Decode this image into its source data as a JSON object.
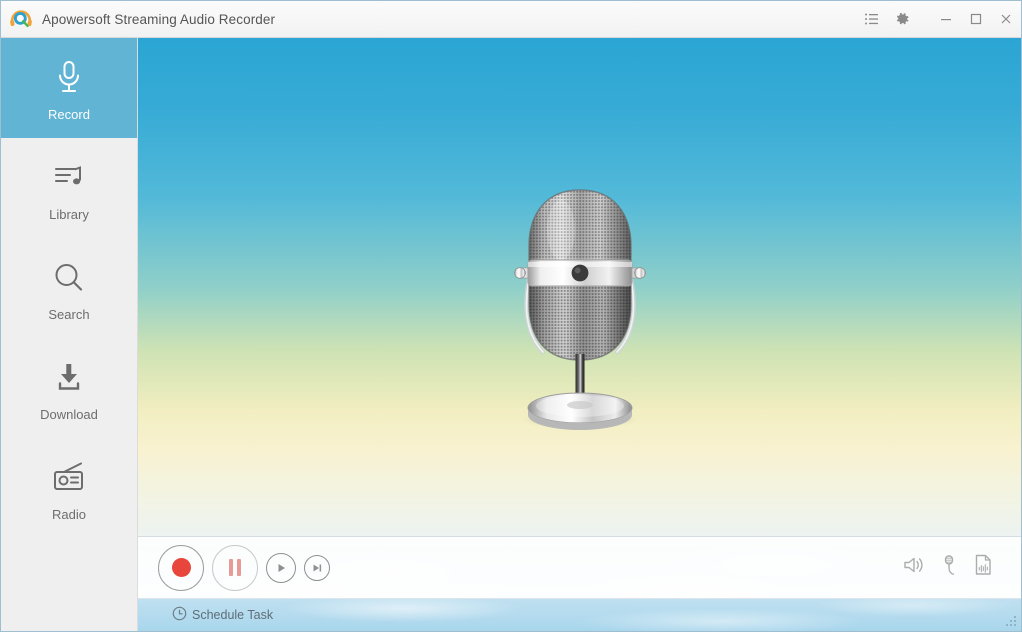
{
  "window": {
    "title": "Apowersoft Streaming Audio Recorder",
    "logo_icon": "apowersoft-logo-icon",
    "controls": [
      {
        "name": "list-icon",
        "label": "List"
      },
      {
        "name": "gear-icon",
        "label": "Settings"
      },
      {
        "name": "minimize-icon",
        "label": "Minimize"
      },
      {
        "name": "maximize-icon",
        "label": "Maximize"
      },
      {
        "name": "close-icon",
        "label": "Close"
      }
    ]
  },
  "sidebar": {
    "active_index": 0,
    "items": [
      {
        "label": "Record",
        "icon": "microphone-icon"
      },
      {
        "label": "Library",
        "icon": "library-music-icon"
      },
      {
        "label": "Search",
        "icon": "search-icon"
      },
      {
        "label": "Download",
        "icon": "download-icon"
      },
      {
        "label": "Radio",
        "icon": "radio-icon"
      }
    ]
  },
  "stage": {
    "artwork": "retro-microphone-illustration",
    "background": "sky-gradient-with-clouds"
  },
  "controls": {
    "transport": [
      {
        "name": "record-button",
        "label": "Record",
        "state": "enabled"
      },
      {
        "name": "pause-button",
        "label": "Pause",
        "state": "disabled"
      },
      {
        "name": "play-button",
        "label": "Play",
        "state": "enabled"
      },
      {
        "name": "next-button",
        "label": "Next",
        "state": "enabled"
      }
    ],
    "right_tools": [
      {
        "name": "volume-icon",
        "label": "Volume"
      },
      {
        "name": "audio-source-icon",
        "label": "Audio Source"
      },
      {
        "name": "audio-file-icon",
        "label": "Audio Format"
      }
    ]
  },
  "statusbar": {
    "schedule_label": "Schedule Task",
    "schedule_icon": "clock-icon",
    "resize_grip": "resize-grip-icon"
  },
  "colors": {
    "accent_blue": "#62b4d5",
    "record_red": "#e8453c",
    "sidebar_bg": "#efefef",
    "statusbar_blue": "#a9d6ec",
    "logo_orange": "#f0a33a"
  }
}
